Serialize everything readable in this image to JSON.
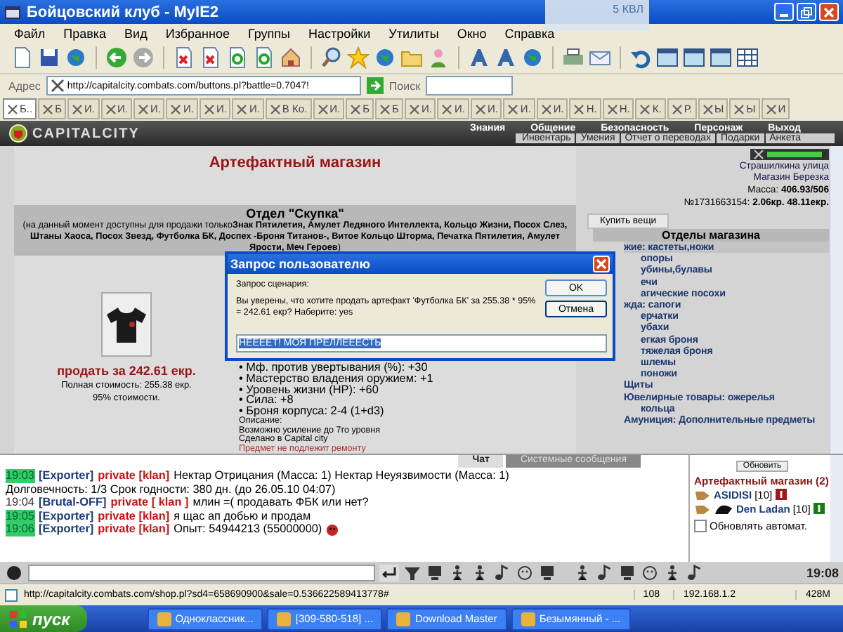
{
  "window": {
    "title": "Бойцовский клуб - MyIE2",
    "notification": "5 КВЛ"
  },
  "menu": [
    "Файл",
    "Правка",
    "Вид",
    "Избранное",
    "Группы",
    "Настройки",
    "Утилиты",
    "Окно",
    "Справка"
  ],
  "address_bar": {
    "label": "Адрес",
    "value": "http://capitalcity.combats.com/buttons.pl?battle=0.7047!",
    "search_label": "Поиск"
  },
  "tabs": [
    {
      "label": "Б..",
      "selected": true
    },
    {
      "label": "Б",
      "selected": false
    },
    {
      "label": "И.",
      "selected": false
    },
    {
      "label": "И.",
      "selected": false
    },
    {
      "label": "И.",
      "selected": false
    },
    {
      "label": "И.",
      "selected": false
    },
    {
      "label": "И.",
      "selected": false
    },
    {
      "label": "И.",
      "selected": false
    },
    {
      "label": "В Ко.",
      "selected": false
    },
    {
      "label": "И.",
      "selected": false
    },
    {
      "label": "Б",
      "selected": false
    },
    {
      "label": "Б",
      "selected": false
    },
    {
      "label": "И.",
      "selected": false
    },
    {
      "label": "И.",
      "selected": false
    },
    {
      "label": "И.",
      "selected": false
    },
    {
      "label": "И.",
      "selected": false
    },
    {
      "label": "И.",
      "selected": false
    },
    {
      "label": "Н.",
      "selected": false
    },
    {
      "label": "Н.",
      "selected": false
    },
    {
      "label": "К.",
      "selected": false
    },
    {
      "label": "Р.",
      "selected": false
    },
    {
      "label": "Ы",
      "selected": false
    },
    {
      "label": "Ы",
      "selected": false
    },
    {
      "label": "И",
      "selected": false
    }
  ],
  "game_nav": {
    "logo": "CAPITALCITY",
    "items": [
      "Знания",
      "Общение",
      "Безопасность",
      "Персонаж",
      "Выход"
    ],
    "subitems": [
      "Инвентарь",
      "Умения",
      "Отчет о переводах",
      "Подарки",
      "Анкета"
    ]
  },
  "shop": {
    "title": "Артефактный магазин",
    "department": "Отдел \"Скупка\"",
    "note": "(на данный момент доступны для продажи только**Знак Пятилетия, Амулет Ледяного Интеллекта, Кольцо Жизни, Посох Слез, Штаны Хаоса, Посох Звезд, Футболка БК, Доспех -Броня Титанов-, Витое Кольцо Шторма, Печатка Пятилетия, Амулет Ярости, Меч Героев**)",
    "item": {
      "sell_link": "продать за 242.61 екр.",
      "full_price": "Полная стоимость: 255.38 екр.",
      "percent": "95% стоимости.",
      "properties": [
        "• Мф. против увертывания (%): +30",
        "• Мастерство владения оружием: +1",
        "• Уровень жизни (HP): +60",
        "• Сила: +8",
        "• Броня корпуса: 2-4 (1+d3)"
      ],
      "description_label": "Описание:",
      "description": [
        "Возможно усиление до 7го уровня",
        "Сделано в Capital city"
      ],
      "repair_note": "Предмет не подлежит ремонту"
    }
  },
  "side": {
    "indicator": {
      "level": 0.92
    },
    "links": [
      "Страшилкина улица",
      "Магазин Березка"
    ],
    "mass_label": "Масса:",
    "mass": "406.93/506",
    "account": "№1731663154:",
    "money": "2.06кр. 48.11екр.",
    "buy_button": "Купить вещи",
    "departments_title": "Отделы магазина",
    "departments": [
      {
        "label": "жие: кастеты,ножи",
        "selected": true,
        "children": [
          {
            "label": "опоры",
            "selected": false
          },
          {
            "label": "убины,булавы",
            "selected": false
          },
          {
            "label": "ечи",
            "selected": false
          },
          {
            "label": "агические посохи",
            "selected": false
          }
        ]
      },
      {
        "label": "жда: сапоги",
        "selected": false,
        "children": [
          {
            "label": "ерчатки",
            "selected": false
          },
          {
            "label": "убахи",
            "selected": false
          },
          {
            "label": "егкая броня",
            "selected": false
          },
          {
            "label": "тяжелая броня",
            "selected": false
          },
          {
            "label": "шлемы",
            "selected": false
          },
          {
            "label": "поножи",
            "selected": false
          }
        ]
      },
      {
        "label": "Щиты",
        "selected": false
      },
      {
        "label": "Ювелирные товары: ожерелья",
        "selected": false,
        "children": [
          {
            "label": "кольца",
            "selected": false
          }
        ]
      },
      {
        "label": "Амуниция: Дополнительные предметы",
        "selected": false
      }
    ]
  },
  "dialog": {
    "title": "Запрос пользователю",
    "caption": "Запрос сценария:",
    "message": "Вы уверены, что хотите продать артефакт 'Футболка БК' за 255.38 * 95% = 242.61 екр? Наберите: yes",
    "value": "НЕЕЕЕТ! МОЯ ПРЕЛЛЕЕЕСТЬ",
    "ok": "OK",
    "cancel": "Отмена"
  },
  "chat": {
    "tabs": [
      {
        "label": "Чат",
        "selected": true
      },
      {
        "label": "Системные сообщения",
        "selected": false
      }
    ],
    "messages": [
      {
        "time": "19:03",
        "highlighted": true,
        "sender": "[Exporter]",
        "channel": "private [klan]",
        "text": "Нектар Отрицания (Масса: 1) Нектар Неуязвимости (Масса: 1)"
      },
      {
        "text": "Долговечность: 1/3 Срок годности: 380 дн. (до 26.05.10 04:07)"
      },
      {
        "time": "19:04",
        "highlighted": false,
        "sender": "[Brutal-OFF]",
        "channel": "private [ klan ]",
        "text": "млин =( продавать ФБК или нет?"
      },
      {
        "time": "19:05",
        "highlighted": true,
        "sender": "[Exporter]",
        "channel": "private [klan]",
        "text": "я щас ап добью и продам"
      },
      {
        "time": "19:06",
        "highlighted": true,
        "sender": "[Exporter]",
        "channel": "private [klan]",
        "text": "Опыт: 54944213 (55000000)"
      }
    ],
    "clock": "19:08"
  },
  "online": {
    "refresh": "Обновить",
    "room": "Артефактный магазин (2)",
    "users": [
      {
        "name": "ASIDISI",
        "level": "[10]",
        "color": "#a01818"
      },
      {
        "name": "Den Ladan",
        "level": "[10]",
        "color": "#1a7a1a"
      }
    ],
    "auto_refresh": {
      "label": "Обновлять автомат.",
      "checked": false
    }
  },
  "status_bar": {
    "url": "http://capitalcity.combats.com/shop.pl?sd4=658690900&sale=0.536622589413778#",
    "count": "108",
    "ip": "192.168.1.2",
    "memory": "428M"
  },
  "taskbar": {
    "start": "пуск",
    "tasks": [
      "Одноклассник...",
      "[309-580-518] ...",
      "Download Master",
      "Безымянный - ..."
    ]
  }
}
